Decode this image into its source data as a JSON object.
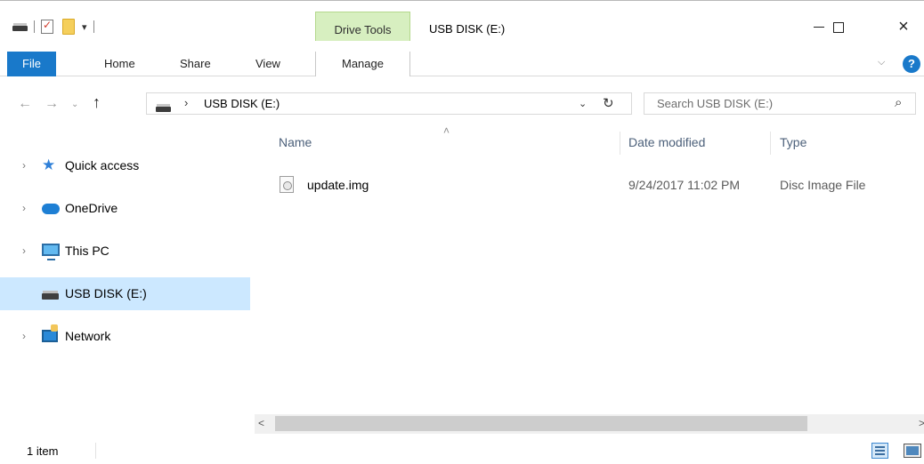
{
  "window": {
    "title": "USB DISK (E:)",
    "context_tab_group": "Drive Tools",
    "minimize_icon": "minimize-icon",
    "maximize_icon": "maximize-icon",
    "close_glyph": "×"
  },
  "ribbon": {
    "tabs": [
      {
        "label": "File"
      },
      {
        "label": "Home"
      },
      {
        "label": "Share"
      },
      {
        "label": "View"
      },
      {
        "label": "Manage"
      }
    ],
    "expand_glyph": "⌵",
    "help_glyph": "?"
  },
  "address": {
    "back_glyph": "←",
    "forward_glyph": "→",
    "recent_glyph": "⌄",
    "up_glyph": "↑",
    "separator": "›",
    "path": "USB DISK (E:)",
    "dropdown_glyph": "⌄",
    "refresh_glyph": "↻"
  },
  "search": {
    "placeholder": "Search USB DISK (E:)",
    "icon_glyph": "⌕"
  },
  "nav_pane": {
    "items": [
      {
        "label": "Quick access",
        "icon": "quick-access-star-icon",
        "expandable": true
      },
      {
        "label": "OneDrive",
        "icon": "onedrive-cloud-icon",
        "expandable": true
      },
      {
        "label": "This PC",
        "icon": "computer-icon",
        "expandable": true
      },
      {
        "label": "USB DISK (E:)",
        "icon": "usb-drive-icon",
        "expandable": false,
        "selected": true
      },
      {
        "label": "Network",
        "icon": "network-icon",
        "expandable": true
      }
    ],
    "chevron_glyph": "›"
  },
  "file_list": {
    "columns": [
      "Name",
      "Date modified",
      "Type"
    ],
    "sort_glyph": "˄",
    "rows": [
      {
        "name": "update.img",
        "date_modified": "9/24/2017 11:02 PM",
        "type": "Disc Image File",
        "icon": "disc-image-file-icon"
      }
    ]
  },
  "scrollbar": {
    "left_glyph": "<",
    "right_glyph": ">"
  },
  "status": {
    "item_count": "1 item"
  },
  "colors": {
    "accent": "#1979ca",
    "context_tab": "#d7efc0",
    "selection": "#cce8ff"
  }
}
